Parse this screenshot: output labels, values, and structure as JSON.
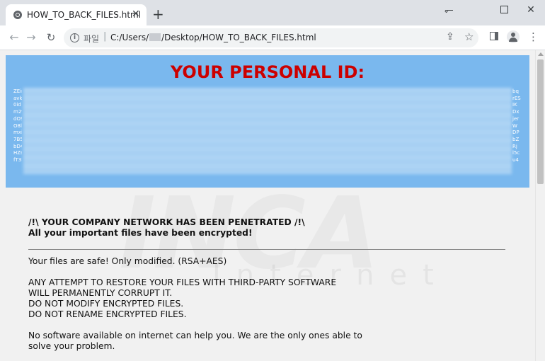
{
  "browser": {
    "tab_title": "HOW_TO_BACK_FILES.html",
    "tab_close": "✕",
    "new_tab": "+",
    "url_prefix": "파일",
    "url_separator": "|",
    "url_part1": "C:/Users/",
    "url_part2": "/Desktop/HOW_TO_BACK_FILES.html",
    "window_close": "✕"
  },
  "page": {
    "banner_title": "YOUR PERSONAL ID:",
    "id_left": [
      "ZEir",
      "avkj",
      "0id",
      "m2v",
      "dOS",
      "O8l",
      "mxi",
      "7B5",
      "bD4",
      "HZs",
      "fT3I"
    ],
    "id_right": [
      "bq",
      "rES",
      "IK",
      "Dx",
      "jer",
      "W",
      "DP",
      "bZ",
      "Rj",
      "l5c",
      "u4"
    ],
    "headline1": "/!\\ YOUR COMPANY NETWORK HAS BEEN PENETRATED /!\\",
    "headline2": "All your important files have been encrypted!",
    "safe_line": "Your files are safe! Only modified. (RSA+AES)",
    "attempt_lines": [
      "ANY ATTEMPT TO RESTORE YOUR FILES WITH THIRD-PARTY SOFTWARE",
      "WILL PERMANENTLY CORRUPT IT.",
      "DO NOT MODIFY ENCRYPTED FILES.",
      "DO NOT RENAME ENCRYPTED FILES."
    ],
    "nosoft_lines": [
      "No software available on internet can help you. We are the only ones able to",
      "solve your problem."
    ],
    "watermark": "INCA",
    "watermark_sub": "Internet"
  },
  "colors": {
    "banner_bg": "#7ab8ee",
    "banner_title": "#cc0000",
    "page_bg": "#f1f1f1"
  },
  "icons": [
    "globe-icon",
    "close-icon",
    "plus-icon",
    "back-icon",
    "forward-icon",
    "reload-icon",
    "info-icon",
    "share-icon",
    "star-icon",
    "side-panel-icon",
    "profile-icon",
    "menu-icon"
  ]
}
